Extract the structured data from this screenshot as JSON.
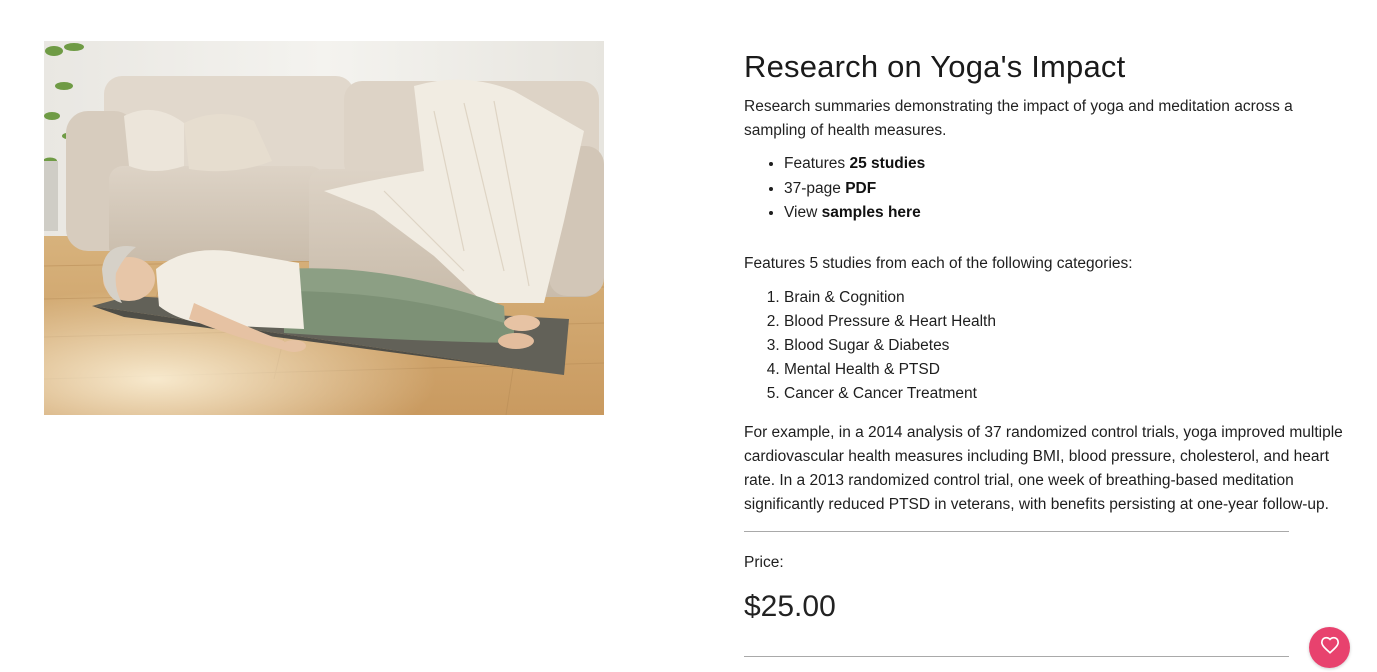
{
  "product": {
    "title": "Research on Yoga's Impact",
    "description": "Research summaries demonstrating the impact of yoga and meditation across a sampling of health measures.",
    "features": [
      {
        "prefix": "Features ",
        "bold": "25 studies"
      },
      {
        "prefix": "37-page ",
        "bold": "PDF"
      },
      {
        "prefix": "View ",
        "bold": "samples here"
      }
    ],
    "categories_intro": "Features 5 studies from each of the following categories:",
    "categories": [
      "Brain & Cognition",
      "Blood Pressure & Heart Health",
      "Blood Sugar & Diabetes",
      "Mental Health & PTSD",
      "Cancer & Cancer Treatment"
    ],
    "example": "For example, in a 2014 analysis of 37 randomized control trials, yoga improved multiple cardiovascular health measures including BMI, blood pressure, cholesterol, and heart rate. In a 2013 randomized control trial, one week of breathing-based meditation significantly reduced PTSD in veterans, with benefits persisting at one-year follow-up.",
    "price_label": "Price:",
    "price": "$25.00"
  },
  "image": {
    "subject": "woman-lying-on-yoga-mat"
  },
  "favorite_button": {
    "icon": "heart-icon",
    "color": "#e8426e"
  }
}
